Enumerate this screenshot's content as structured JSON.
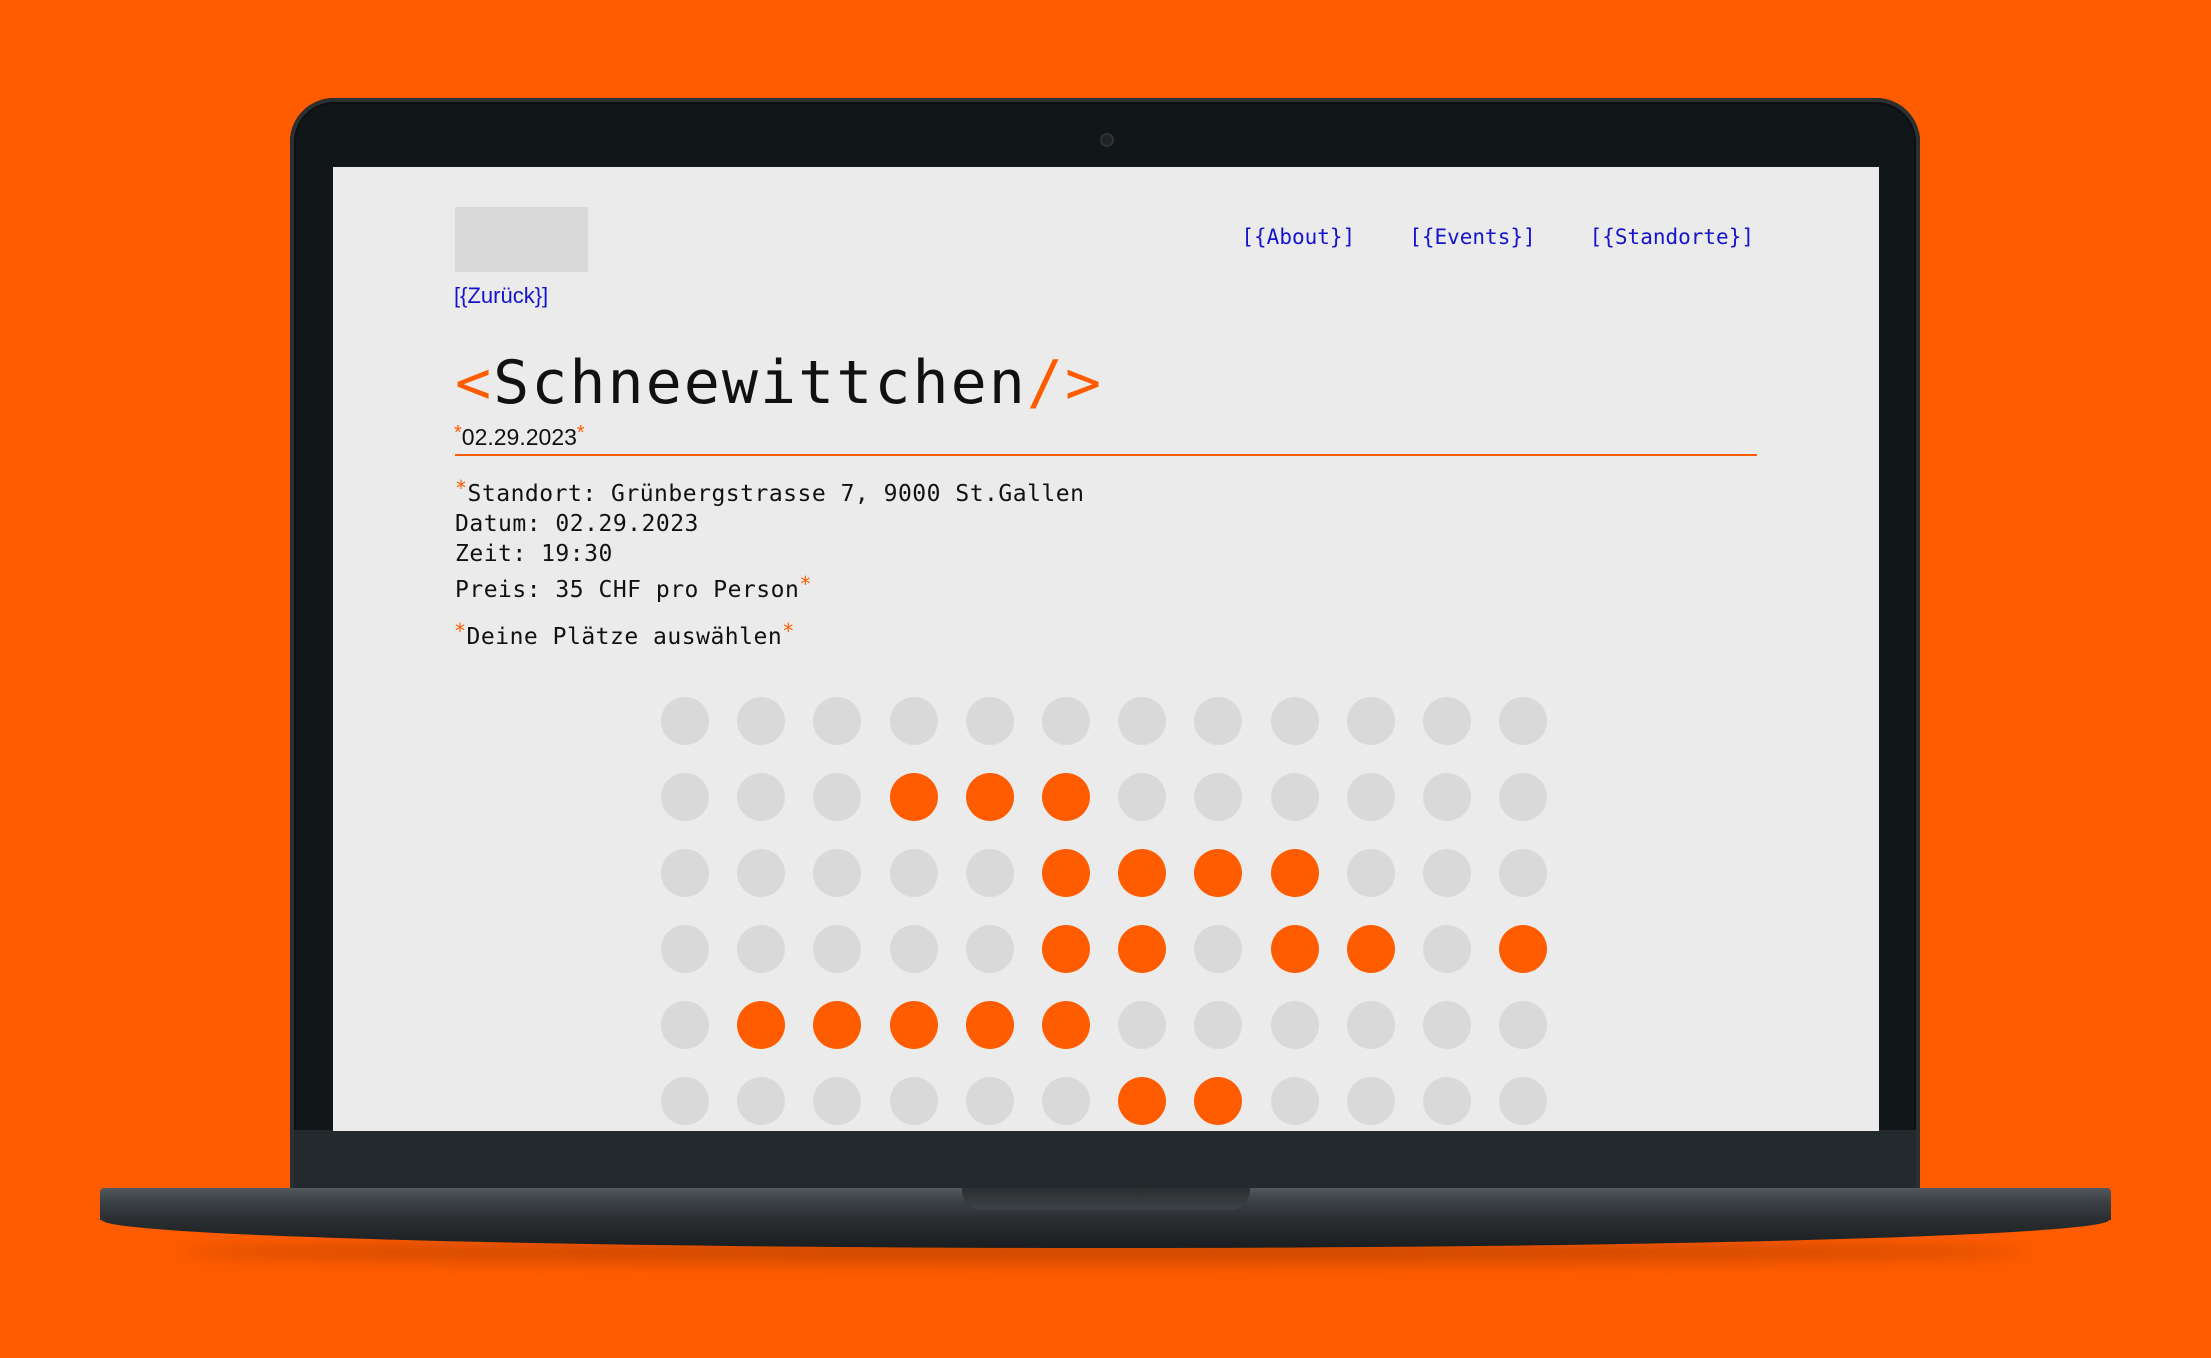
{
  "colors": {
    "background": "#ff5c00",
    "accent": "#ff5c00",
    "link": "#1414cc",
    "seat_free": "#d9d9d9",
    "seat_selected": "#ff5c00",
    "screen_bg": "#ebebeb"
  },
  "header": {
    "back_label": "[{Zurück}]",
    "nav": [
      {
        "label": "[{About}]"
      },
      {
        "label": "[{Events}]"
      },
      {
        "label": "[{Standorte}]"
      }
    ]
  },
  "event": {
    "title_open": "<",
    "title": "Schneewittchen",
    "title_close_slash": "/",
    "title_close": ">",
    "asterisk": "*",
    "date": "02.29.2023",
    "details": {
      "standort": "Standort: Grünbergstrasse 7, 9000 St.Gallen",
      "datum": "Datum: 02.29.2023",
      "zeit": "Zeit: 19:30",
      "preis": "Preis: 35 CHF pro Person"
    },
    "choose_seats": "Deine Plätze auswählen"
  },
  "seats": {
    "columns": 12,
    "rows": [
      [
        0,
        0,
        0,
        0,
        0,
        0,
        0,
        0,
        0,
        0,
        0,
        0
      ],
      [
        0,
        0,
        0,
        1,
        1,
        1,
        0,
        0,
        0,
        0,
        0,
        0
      ],
      [
        0,
        0,
        0,
        0,
        0,
        1,
        1,
        1,
        1,
        0,
        0,
        0
      ],
      [
        0,
        0,
        0,
        0,
        0,
        1,
        1,
        0,
        1,
        1,
        0,
        1
      ],
      [
        0,
        1,
        1,
        1,
        1,
        1,
        0,
        0,
        0,
        0,
        0,
        0
      ],
      [
        0,
        0,
        0,
        0,
        0,
        0,
        1,
        1,
        0,
        0,
        0,
        0
      ]
    ]
  }
}
